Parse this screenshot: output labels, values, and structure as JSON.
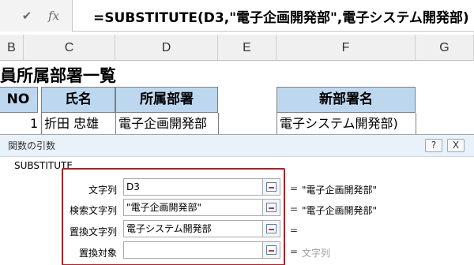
{
  "formula_bar": {
    "confirm_icon": "✔",
    "fx_icon": "fx",
    "formula": "=SUBSTITUTE(D3,\"電子企画開発部\",電子システム開発部)"
  },
  "columns": [
    "B",
    "C",
    "D",
    "E",
    "F",
    "G"
  ],
  "sheet": {
    "title": "員所属部署一覧",
    "headers": {
      "no": "NO",
      "name": "氏名",
      "dept": "所属部署",
      "new_dept": "新部署名"
    },
    "row1": {
      "no": "1",
      "name": "折田 忠雄",
      "dept": "電子企画開発部",
      "new_dept": "電子システム開発部)"
    }
  },
  "dialog": {
    "title": "関数の引数",
    "help_label": "?",
    "close_label": "X",
    "function_name": "SUBSTITUTE",
    "args": [
      {
        "label": "文字列",
        "value": "D3",
        "result": "\"電子企画開発部\"",
        "result_gray": false
      },
      {
        "label": "検索文字列",
        "value": "\"電子企画開発部\"",
        "result": "\"電子企画開発部\"",
        "result_gray": false
      },
      {
        "label": "置換文字列",
        "value": "電子システム開発部",
        "result": "",
        "result_gray": false
      },
      {
        "label": "置換対象",
        "value": "",
        "result": "文字列",
        "result_gray": true
      }
    ],
    "equals": "="
  },
  "colors": {
    "header_fill": "#bdd7ee",
    "highlight_border": "#a5242a",
    "titlebar": "#e9f1fb"
  }
}
